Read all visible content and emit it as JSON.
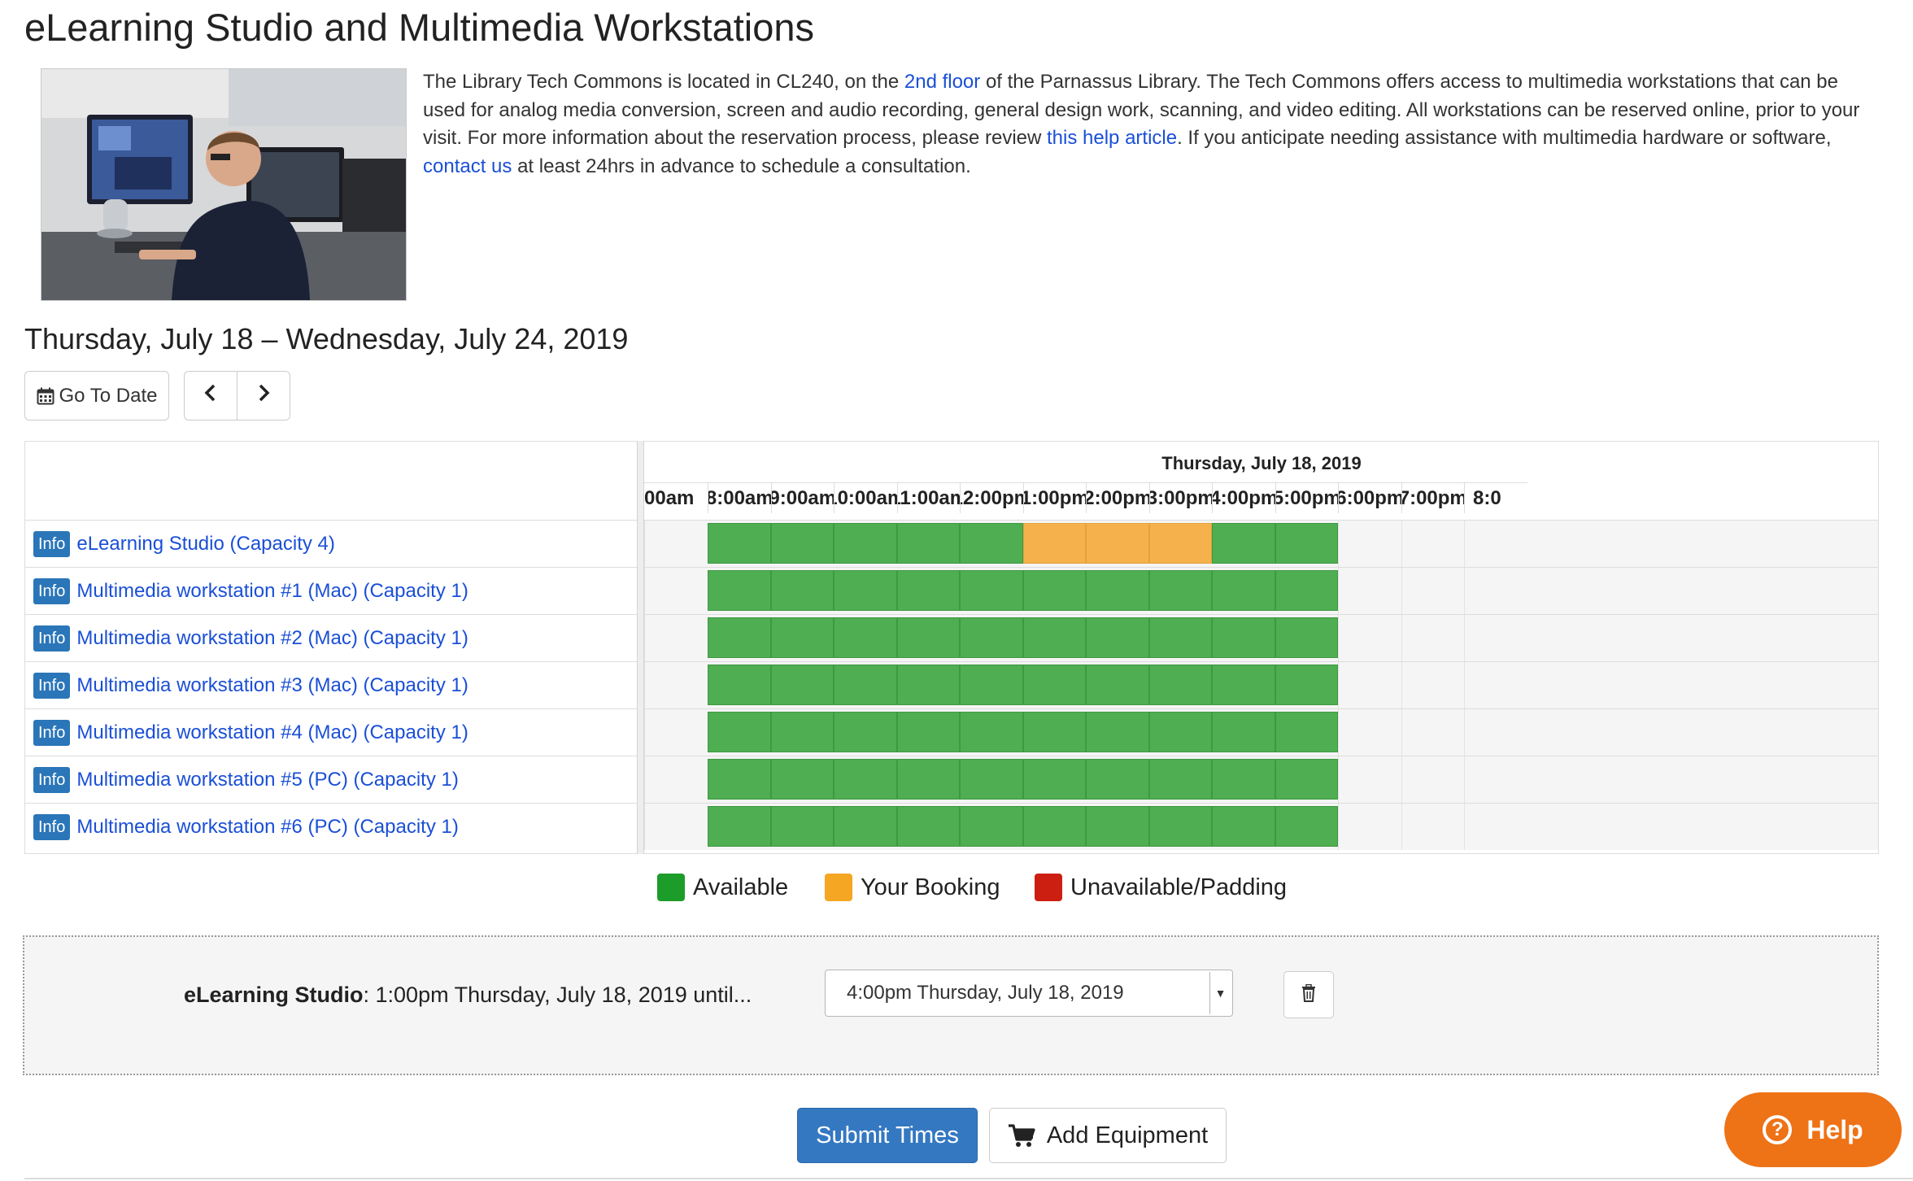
{
  "page": {
    "title": "eLearning Studio and Multimedia Workstations"
  },
  "intro": {
    "p1": "The Library Tech Commons is located in CL240, on the ",
    "link_floor": "2nd floor",
    "p2": " of the Parnassus Library. The Tech Commons offers access to multimedia workstations that can be used for analog media conversion, screen and audio recording, general design work, scanning, and video editing. All workstations can be reserved online, prior to your visit. For more information about the reservation process, please review ",
    "link_help": "this help article",
    "p3": ". If you anticipate needing assistance with multimedia hardware or software, ",
    "link_contact": "contact us",
    "p4": " at least 24hrs in advance to schedule a consultation."
  },
  "date_range": "Thursday, July 18 – Wednesday, July 24, 2019",
  "nav": {
    "goto_label": "Go To Date",
    "calendar_icon": "calendar-icon",
    "prev_icon": "chevron-left-icon",
    "next_icon": "chevron-right-icon"
  },
  "grid": {
    "day_label": "Thursday, July 18, 2019",
    "hours": [
      "00am",
      "8:00am",
      "9:00am",
      "10:00am",
      "11:00am",
      "12:00pm",
      "1:00pm",
      "2:00pm",
      "3:00pm",
      "4:00pm",
      "5:00pm",
      "6:00pm",
      "7:00pm",
      "8:0"
    ],
    "info_label": "Info",
    "resources": [
      {
        "name": "eLearning Studio (Capacity 4)",
        "slots": [
          "none",
          "avail",
          "avail",
          "avail",
          "avail",
          "avail",
          "booked",
          "booked",
          "booked",
          "avail",
          "avail",
          "none",
          "none",
          "none"
        ]
      },
      {
        "name": "Multimedia workstation #1 (Mac) (Capacity 1)",
        "slots": [
          "none",
          "avail",
          "avail",
          "avail",
          "avail",
          "avail",
          "avail",
          "avail",
          "avail",
          "avail",
          "avail",
          "none",
          "none",
          "none"
        ]
      },
      {
        "name": "Multimedia workstation #2 (Mac) (Capacity 1)",
        "slots": [
          "none",
          "avail",
          "avail",
          "avail",
          "avail",
          "avail",
          "avail",
          "avail",
          "avail",
          "avail",
          "avail",
          "none",
          "none",
          "none"
        ]
      },
      {
        "name": "Multimedia workstation #3 (Mac) (Capacity 1)",
        "slots": [
          "none",
          "avail",
          "avail",
          "avail",
          "avail",
          "avail",
          "avail",
          "avail",
          "avail",
          "avail",
          "avail",
          "none",
          "none",
          "none"
        ]
      },
      {
        "name": "Multimedia workstation #4 (Mac) (Capacity 1)",
        "slots": [
          "none",
          "avail",
          "avail",
          "avail",
          "avail",
          "avail",
          "avail",
          "avail",
          "avail",
          "avail",
          "avail",
          "none",
          "none",
          "none"
        ]
      },
      {
        "name": "Multimedia workstation #5 (PC) (Capacity 1)",
        "slots": [
          "none",
          "avail",
          "avail",
          "avail",
          "avail",
          "avail",
          "avail",
          "avail",
          "avail",
          "avail",
          "avail",
          "none",
          "none",
          "none"
        ]
      },
      {
        "name": "Multimedia workstation #6 (PC) (Capacity 1)",
        "slots": [
          "none",
          "avail",
          "avail",
          "avail",
          "avail",
          "avail",
          "avail",
          "avail",
          "avail",
          "avail",
          "avail",
          "none",
          "none",
          "none"
        ]
      }
    ]
  },
  "legend": {
    "available": "Available",
    "booking": "Your Booking",
    "unavailable": "Unavailable/Padding",
    "colors": {
      "available": "#1c9c28",
      "booking": "#f5a623",
      "unavailable": "#cc1f12"
    }
  },
  "selection": {
    "resource": "eLearning Studio",
    "start_text": ": 1:00pm Thursday, July 18, 2019 until...",
    "end_value": "4:00pm Thursday, July 18, 2019",
    "delete_icon": "trash-icon"
  },
  "actions": {
    "submit_label": "Submit Times",
    "equipment_label": "Add Equipment",
    "equipment_icon": "cart-icon"
  },
  "help": {
    "label": "Help",
    "icon": "question-circle-icon"
  },
  "colors": {
    "slot_available": "#4fad52",
    "slot_booked": "#f5b24c",
    "primary": "#3478c1",
    "help": "#ee7216",
    "link": "#1a4fd6"
  }
}
